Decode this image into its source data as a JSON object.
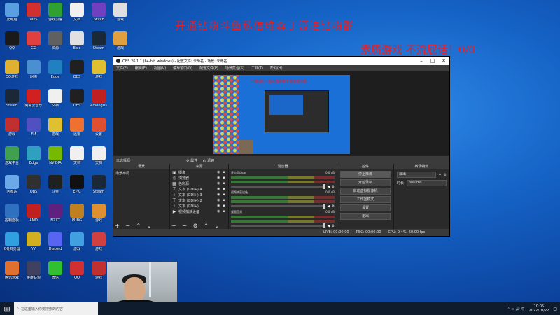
{
  "overlay": {
    "line1": "开通钻粉斗鱼私信维森丁源进钻粉群",
    "line2": "素质游戏 不流屁话！0/0"
  },
  "desktop_icons": [
    {
      "label": "此电脑",
      "color": "#5aa0e0",
      "icon": "computer-icon"
    },
    {
      "label": "QQ",
      "color": "#1a1a1a",
      "icon": "qq-icon"
    },
    {
      "label": "QQ游戏",
      "color": "#e0b030",
      "icon": "qq-game-icon"
    },
    {
      "label": "Steam",
      "color": "#1b2838",
      "icon": "steam-icon"
    },
    {
      "label": "游戏",
      "color": "#c03030",
      "icon": "game-icon"
    },
    {
      "label": "游戏平台",
      "color": "#40a050",
      "icon": "game-platform-icon"
    },
    {
      "label": "回收站",
      "color": "#6aa8e8",
      "icon": "recycle-bin-icon"
    },
    {
      "label": "控制面板",
      "color": "#3070c0",
      "icon": "control-panel-icon"
    },
    {
      "label": "QQ浏览器",
      "color": "#30a0e0",
      "icon": "browser-icon"
    },
    {
      "label": "腾讯游戏",
      "color": "#e07030",
      "icon": "tencent-game-icon"
    },
    {
      "label": "WPS",
      "color": "#d03030",
      "icon": "wps-icon"
    },
    {
      "label": "GG",
      "color": "#e04040",
      "icon": "gg-icon"
    },
    {
      "label": "网络",
      "color": "#4a90d0",
      "icon": "network-icon"
    },
    {
      "label": "网易云音乐",
      "color": "#d02020",
      "icon": "music-icon"
    },
    {
      "label": "FM",
      "color": "#5050c0",
      "icon": "fm-icon"
    },
    {
      "label": "Edge",
      "color": "#30a0c0",
      "icon": "edge-icon"
    },
    {
      "label": "OBS",
      "color": "#303030",
      "icon": "obs-icon"
    },
    {
      "label": "AMD",
      "color": "#c02020",
      "icon": "amd-icon"
    },
    {
      "label": "YY",
      "color": "#d0b020",
      "icon": "yy-icon"
    },
    {
      "label": "英雄联盟",
      "color": "#404060",
      "icon": "lol-icon"
    },
    {
      "label": "游戏加速",
      "color": "#30a030",
      "icon": "accelerator-icon"
    },
    {
      "label": "资源",
      "color": "#606060",
      "icon": "resource-icon"
    },
    {
      "label": "Edge",
      "color": "#2080c0",
      "icon": "edge-icon"
    },
    {
      "label": "文档",
      "color": "#f0f0f0",
      "icon": "document-icon"
    },
    {
      "label": "游戏",
      "color": "#e0c030",
      "icon": "game-icon"
    },
    {
      "label": "NVIDIA",
      "color": "#76b900",
      "icon": "nvidia-icon"
    },
    {
      "label": "斗鱼",
      "color": "#202020",
      "icon": "douyu-icon"
    },
    {
      "label": "NZXT",
      "color": "#602080",
      "icon": "nzxt-icon"
    },
    {
      "label": "Discord",
      "color": "#5865f2",
      "icon": "discord-icon"
    },
    {
      "label": "微信",
      "color": "#30c030",
      "icon": "wechat-icon"
    },
    {
      "label": "文档",
      "color": "#f0f0f0",
      "icon": "document-icon"
    },
    {
      "label": "Epic",
      "color": "#e0e0e0",
      "icon": "epic-icon"
    },
    {
      "label": "OBS",
      "color": "#202020",
      "icon": "obs-icon"
    },
    {
      "label": "OBS",
      "color": "#202020",
      "icon": "obs-icon"
    },
    {
      "label": "迅雷",
      "color": "#f07030",
      "icon": "thunder-icon"
    },
    {
      "label": "文档",
      "color": "#f0f0f0",
      "icon": "document-icon"
    },
    {
      "label": "EPIC",
      "color": "#111111",
      "icon": "epic-icon"
    },
    {
      "label": "PUBG",
      "color": "#c08020",
      "icon": "pubg-icon"
    },
    {
      "label": "游戏",
      "color": "#40a0e0",
      "icon": "game-icon"
    },
    {
      "label": "QQ",
      "color": "#d03030",
      "icon": "qq-icon"
    },
    {
      "label": "Twitch",
      "color": "#7040c0",
      "icon": "twitch-icon"
    },
    {
      "label": "Steam",
      "color": "#1b2838",
      "icon": "steam-icon"
    },
    {
      "label": "游戏",
      "color": "#e0c030",
      "icon": "game-icon"
    },
    {
      "label": "AmongUs",
      "color": "#c02020",
      "icon": "amongus-icon"
    },
    {
      "label": "设置",
      "color": "#e05030",
      "icon": "settings-icon"
    },
    {
      "label": "文档",
      "color": "#f0f0f0",
      "icon": "document-icon"
    },
    {
      "label": "Steam",
      "color": "#1b2838",
      "icon": "steam-icon"
    },
    {
      "label": "游戏",
      "color": "#e09030",
      "icon": "game-icon"
    },
    {
      "label": "游戏",
      "color": "#d04040",
      "icon": "game-icon"
    },
    {
      "label": "游戏",
      "color": "#c03030",
      "icon": "game-icon"
    },
    {
      "label": "游戏",
      "color": "#e0e0e0",
      "icon": "game-icon"
    },
    {
      "label": "游戏",
      "color": "#e0a040",
      "icon": "game-icon"
    }
  ],
  "obs": {
    "title": "OBS 26.1.1 (64-bit, windows) - 配置文件: 未命名 - 场景: 未命名",
    "menu": [
      "文件(F)",
      "编辑(E)",
      "视图(V)",
      "停靠窗口(D)",
      "配置文件(P)",
      "场景集合(S)",
      "工具(T)",
      "帮助(H)"
    ],
    "preview_text": "开通钻粉斗鱼私信维森丁源进钻粉群",
    "scene_bar": {
      "label": "未选择源",
      "props": "属性",
      "filters": "滤镜"
    },
    "docks": {
      "scenes": "场景",
      "sources": "来源",
      "mixer": "混音器",
      "transitions": "转场特效",
      "controls": "控件"
    },
    "scene_items": [
      "场景布局"
    ],
    "sources": [
      {
        "name": "摄像",
        "icon": "camera-icon"
      },
      {
        "name": "浏览器",
        "icon": "browser-icon"
      },
      {
        "name": "色彩源",
        "icon": "color-source-icon"
      },
      {
        "name": "文本 (GDI+) 4",
        "icon": "text-icon"
      },
      {
        "name": "文本 (GDI+) 3",
        "icon": "text-icon"
      },
      {
        "name": "文本 (GDI+) 2",
        "icon": "text-icon"
      },
      {
        "name": "文本 (GDI+)",
        "icon": "text-icon"
      },
      {
        "name": "视频捕获设备",
        "icon": "video-capture-icon"
      }
    ],
    "mixer": [
      {
        "name": "麦克风/Aux",
        "db": "0.0 dB"
      },
      {
        "name": "视频捕获设备",
        "db": "0.0 dB"
      },
      {
        "name": "桌面音频",
        "db": "0.0 dB"
      }
    ],
    "controls": [
      "停止推流",
      "开始录制",
      "启动虚拟摄像机",
      "工作室模式",
      "设置",
      "退出"
    ],
    "transition": {
      "select": "淡出",
      "duration_label": "时长",
      "duration": "300 ms"
    },
    "status": {
      "live": "LIVE: 00:00:00",
      "rec": "REC: 00:00:00",
      "cpu": "CPU: 0.4%, 60.00 fps"
    }
  },
  "taskbar": {
    "search_placeholder": "在这里输入你要搜索的内容",
    "time": "10:05",
    "date": "2022/10/22"
  }
}
